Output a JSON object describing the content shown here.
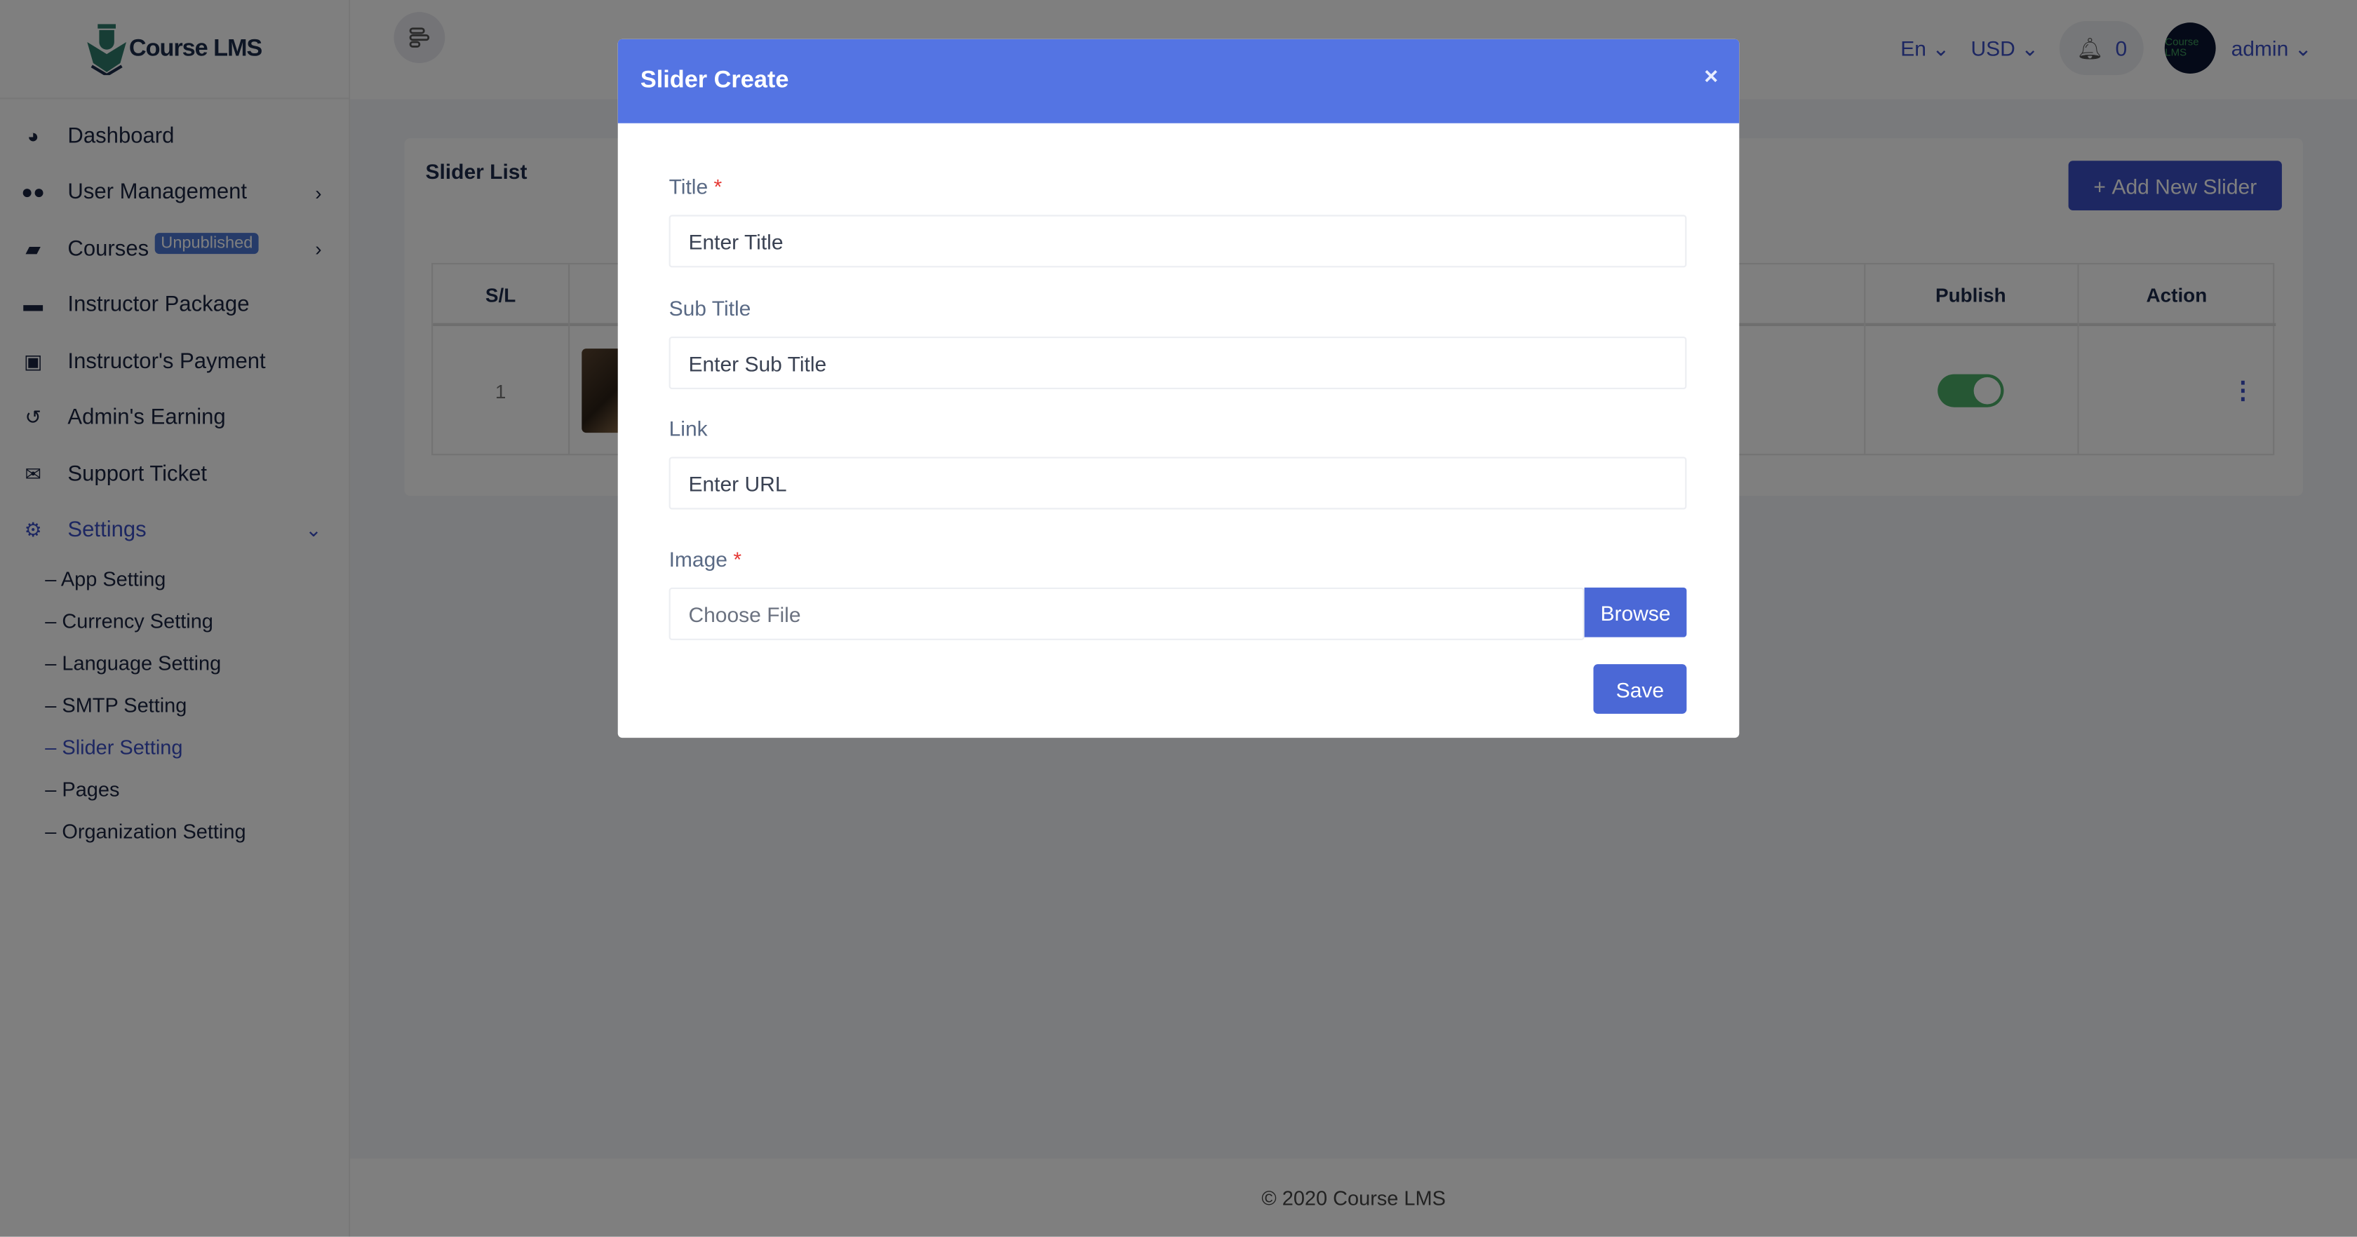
{
  "app": {
    "logo_text": "Course LMS"
  },
  "sidebar": {
    "items": [
      {
        "label": "Dashboard",
        "icon": "dashboard-icon"
      },
      {
        "label": "User Management",
        "icon": "users-icon"
      },
      {
        "label": "Courses",
        "badge": "Unpublished",
        "icon": "book-icon"
      },
      {
        "label": "Instructor Package",
        "icon": "briefcase-icon"
      },
      {
        "label": "Instructor's Payment",
        "icon": "money-icon"
      },
      {
        "label": "Admin's Earning",
        "icon": "history-icon"
      },
      {
        "label": "Support Ticket",
        "icon": "envelope-open-icon"
      },
      {
        "label": "Settings",
        "icon": "gear-icon"
      }
    ],
    "settings_sub": [
      "– App Setting",
      "– Currency Setting",
      "– Language Setting",
      "– SMTP Setting",
      "– Slider Setting",
      "– Pages",
      "– Organization Setting"
    ]
  },
  "topbar": {
    "language": "En",
    "currency": "USD",
    "notifications": "0",
    "user": "admin",
    "avatar_text": "Course LMS"
  },
  "card": {
    "title": "Slider List",
    "add_button": "Add New Slider",
    "columns": [
      "S/L",
      "Publish",
      "Action"
    ],
    "rows": [
      {
        "sl": "1",
        "publish": true
      }
    ]
  },
  "footer": "© 2020 Course LMS",
  "modal": {
    "title": "Slider Create",
    "close": "×",
    "title_label": "Title",
    "title_placeholder": "Enter Title",
    "subtitle_label": "Sub Title",
    "subtitle_placeholder": "Enter Sub Title",
    "link_label": "Link",
    "link_placeholder": "Enter URL",
    "image_label": "Image",
    "file_placeholder": "Choose File",
    "browse": "Browse",
    "save": "Save",
    "required": "*"
  },
  "colors": {
    "primary": "#3b4ec4",
    "modal_header": "#5474e3",
    "toggle_on": "#4caf69"
  }
}
